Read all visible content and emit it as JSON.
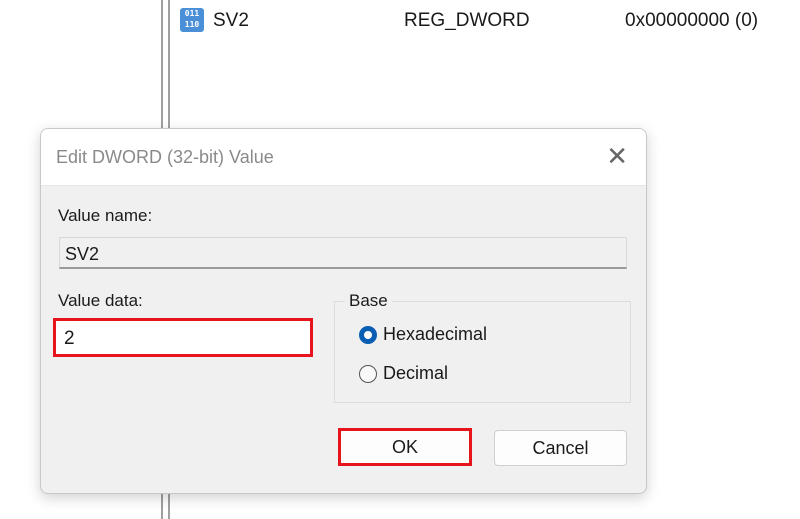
{
  "registry_row": {
    "name": "SV2",
    "type": "REG_DWORD",
    "data": "0x00000000 (0)",
    "icon": "reg-binary-icon",
    "icon_text": "011\n110"
  },
  "dialog": {
    "title": "Edit DWORD (32-bit) Value",
    "value_name_label": "Value name:",
    "value_name": "SV2",
    "value_data_label": "Value data:",
    "value_data": "2",
    "base_label": "Base",
    "base_options": [
      {
        "label": "Hexadecimal",
        "selected": true
      },
      {
        "label": "Decimal",
        "selected": false
      }
    ],
    "ok_label": "OK",
    "cancel_label": "Cancel",
    "close_glyph": "✕"
  },
  "colors": {
    "highlight": "#e8141c",
    "accent": "#0a5fb4"
  }
}
